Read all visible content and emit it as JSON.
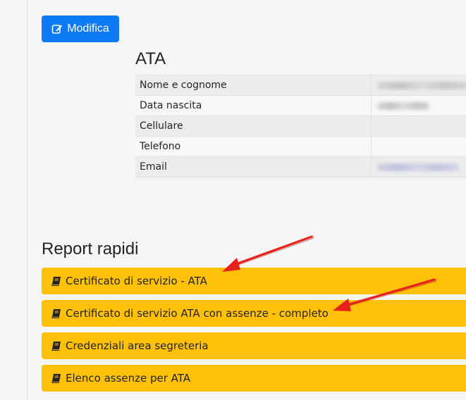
{
  "toolbar": {
    "edit_label": "Modifica"
  },
  "profile": {
    "title": "ATA",
    "rows": [
      {
        "label": "Nome e cognome",
        "value_hidden": true
      },
      {
        "label": "Data nascita",
        "value_hidden": true
      },
      {
        "label": "Cellulare"
      },
      {
        "label": "Telefono"
      },
      {
        "label": "Email",
        "value_hidden": true
      }
    ]
  },
  "reports": {
    "title": "Report rapidi",
    "items": [
      {
        "label": "Certificato di servizio - ATA"
      },
      {
        "label": "Certificato di servizio ATA con assenze - completo"
      },
      {
        "label": "Credenziali area segreteria"
      },
      {
        "label": "Elenco assenze per ATA"
      }
    ]
  },
  "colors": {
    "primary": "#0d7bf5",
    "warning": "#ffc107",
    "annotation_arrow": "#e8201b"
  },
  "icons": {
    "edit": "edit-icon",
    "report": "book-icon",
    "annotation": "red-arrow-icon"
  }
}
